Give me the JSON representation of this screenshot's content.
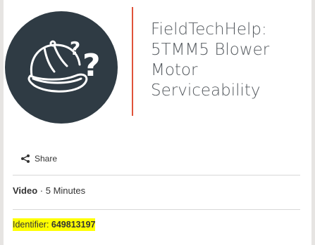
{
  "title_lines": [
    "FieldTechHelp:",
    "5TMM5 Blower",
    "Motor",
    "Serviceability"
  ],
  "share": {
    "label": "Share",
    "icon": "share-icon"
  },
  "meta": {
    "type": "Video",
    "separator": " · ",
    "duration": "5 Minutes"
  },
  "identifier": {
    "label": "Identifier:",
    "value": "649813197"
  },
  "colors": {
    "logo_bg": "#2f3b44",
    "accent": "#e0533a",
    "highlight": "#ffff00"
  },
  "logo": {
    "icon": "cap-question-icon"
  }
}
